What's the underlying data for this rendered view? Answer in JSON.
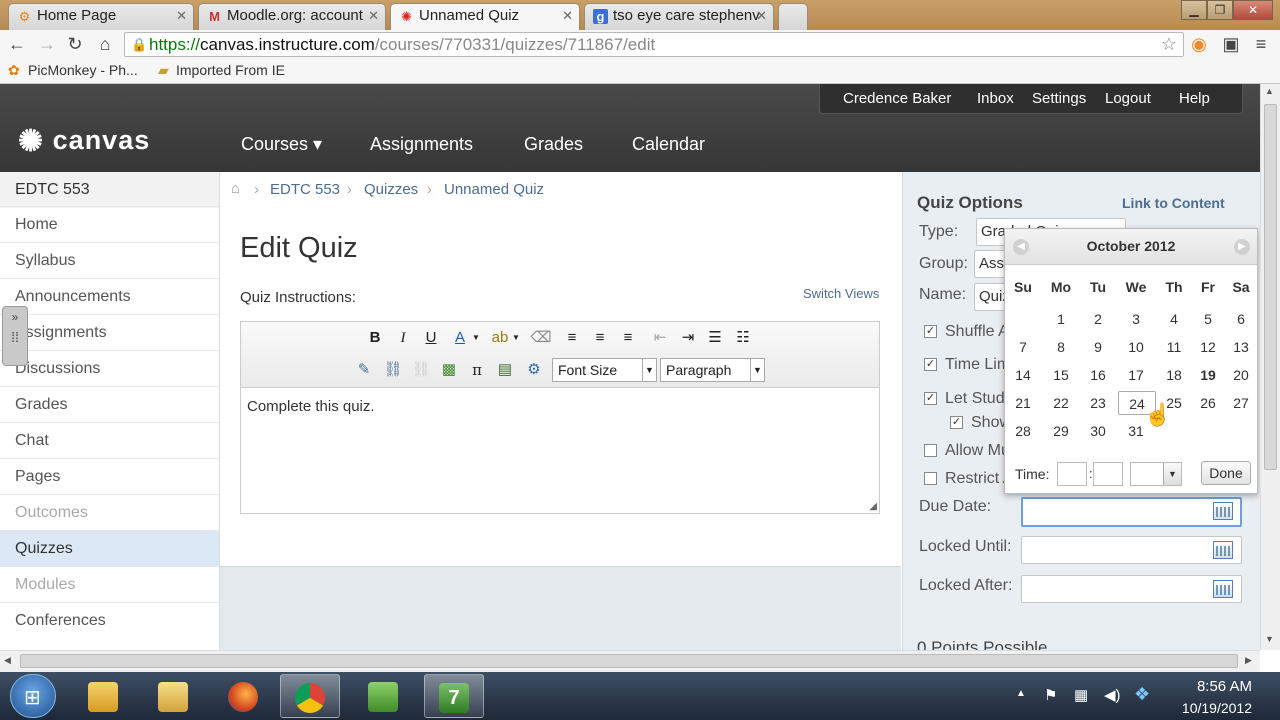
{
  "browser": {
    "tabs": [
      {
        "label": "Home Page",
        "icon": "moodle-icon"
      },
      {
        "label": "Moodle.org: account",
        "icon": "gmail-icon"
      },
      {
        "label": "Unnamed Quiz",
        "icon": "canvas-icon"
      },
      {
        "label": "tso eye care stephenv",
        "icon": "google-icon"
      }
    ],
    "url_scheme": "https://",
    "url_host": "canvas.instructure.com",
    "url_path": "/courses/770331/quizzes/711867/edit",
    "bookmarks": [
      "PicMonkey - Ph...",
      "Imported From IE"
    ]
  },
  "header": {
    "logo": "canvas",
    "user_menu": [
      "Credence Baker",
      "Inbox",
      "Settings",
      "Logout",
      "Help"
    ],
    "nav": [
      "Courses ▾",
      "Assignments",
      "Grades",
      "Calendar"
    ]
  },
  "sidebar": {
    "course": "EDTC 553",
    "items": [
      {
        "label": "Home",
        "state": "normal"
      },
      {
        "label": "Syllabus",
        "state": "normal"
      },
      {
        "label": "Announcements",
        "state": "normal"
      },
      {
        "label": "Assignments",
        "state": "normal"
      },
      {
        "label": "Discussions",
        "state": "normal"
      },
      {
        "label": "Grades",
        "state": "normal"
      },
      {
        "label": "Chat",
        "state": "normal"
      },
      {
        "label": "Pages",
        "state": "normal"
      },
      {
        "label": "Outcomes",
        "state": "muted"
      },
      {
        "label": "Quizzes",
        "state": "active"
      },
      {
        "label": "Modules",
        "state": "muted"
      },
      {
        "label": "Conferences",
        "state": "normal"
      }
    ]
  },
  "breadcrumb": [
    "EDTC 553",
    "Quizzes",
    "Unnamed Quiz"
  ],
  "main": {
    "title": "Edit Quiz",
    "instructions_label": "Quiz Instructions:",
    "switch_views": "Switch Views",
    "font_size": "Font Size",
    "paragraph": "Paragraph",
    "body_text": "Complete this quiz."
  },
  "options": {
    "title": "Quiz Options",
    "link": "Link to Content",
    "type_label": "Type:",
    "type_value": "Graded Quiz",
    "group_label": "Group:",
    "group_value": "Assignments",
    "name_label": "Name:",
    "name_value": "Quiz",
    "checks": [
      {
        "label": "Shuffle Answers",
        "checked": true
      },
      {
        "label": "Time Limit",
        "checked": true
      },
      {
        "label": "Let Students see their quiz responses",
        "checked": true
      },
      {
        "label": "Show Correct Answers",
        "checked": true
      },
      {
        "label": "Allow Multiple Attempts",
        "checked": false
      },
      {
        "label": "Restrict Access",
        "checked": false
      }
    ],
    "due_label": "Due Date:",
    "locked_until_label": "Locked Until:",
    "locked_after_label": "Locked After:",
    "points": "0 Points Possible"
  },
  "datepicker": {
    "month": "October 2012",
    "days_of_week": [
      "Su",
      "Mo",
      "Tu",
      "We",
      "Th",
      "Fr",
      "Sa"
    ],
    "weeks": [
      [
        "",
        "1",
        "2",
        "3",
        "4",
        "5",
        "6"
      ],
      [
        "7",
        "8",
        "9",
        "10",
        "11",
        "12",
        "13"
      ],
      [
        "14",
        "15",
        "16",
        "17",
        "18",
        "19",
        "20"
      ],
      [
        "21",
        "22",
        "23",
        "24",
        "25",
        "26",
        "27"
      ],
      [
        "28",
        "29",
        "30",
        "31",
        "",
        "",
        ""
      ]
    ],
    "today": "19",
    "hovered": "24",
    "time_label": "Time:",
    "done": "Done"
  },
  "taskbar": {
    "time": "8:56 AM",
    "date": "10/19/2012"
  },
  "colors": {
    "accent": "#4b6e91",
    "header": "#3d3d3d",
    "sidebar_bg": "#e9eef2",
    "active_nav": "#dbe8f6"
  }
}
